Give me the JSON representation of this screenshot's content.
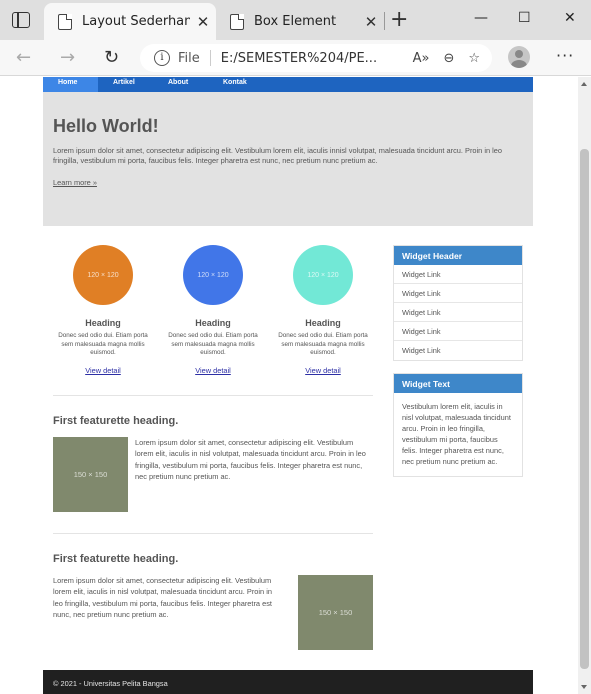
{
  "browser": {
    "tabs": [
      {
        "title": "Layout Sederhana",
        "active": true
      },
      {
        "title": "Box Element",
        "active": false
      }
    ],
    "new_tab_symbol": "+",
    "close_symbol": "✕",
    "window": {
      "minimize": "—",
      "maximize": "☐",
      "close": "✕"
    },
    "address": {
      "protocol": "File",
      "url": "E:/SEMESTER%204/PE..."
    },
    "icons": [
      "tab-actions-icon",
      "back-icon",
      "forward-icon",
      "refresh-icon",
      "info-icon",
      "read-aloud-icon",
      "zoom-icon",
      "favorites-icon",
      "profile-icon",
      "menu-icon"
    ]
  },
  "page": {
    "nav": [
      "Home",
      "Artikel",
      "About",
      "Kontak"
    ],
    "jumbotron": {
      "title": "Hello World!",
      "text": "Lorem ipsum dolor sit amet, consectetur adipiscing elit. Vestibulum lorem elit, iaculis innisl volutpat, malesuada tincidunt arcu. Proin in leo fringilla, vestibulum mi porta, faucibus felis. Integer pharetra est nunc, nec pretium nunc pretium ac.",
      "link": "Learn more »"
    },
    "columns": [
      {
        "img": "120 × 120",
        "heading": "Heading",
        "text": "Donec sed odio dui. Etiam porta sem malesuada magna mollis euismod.",
        "link": "View detail",
        "color": "#e07f25"
      },
      {
        "img": "120 × 120",
        "heading": "Heading",
        "text": "Donec sed odio dui. Etiam porta sem malesuada magna mollis euismod.",
        "link": "View detail",
        "color": "#4176e8"
      },
      {
        "img": "120 × 120",
        "heading": "Heading",
        "text": "Donec sed odio dui. Etiam porta sem malesuada magna mollis euismod.",
        "link": "View detail",
        "color": "#72e8d6"
      }
    ],
    "featurettes": [
      {
        "heading": "First featurette heading.",
        "img": "150 × 150",
        "text": "Lorem ipsum dolor sit amet, consectetur adipiscing elit. Vestibulum lorem elit, iaculis in nisl volutpat, malesuada tincidunt arcu. Proin in leo fringilla, vestibulum mi porta, faucibus felis. Integer pharetra est nunc, nec pretium nunc pretium ac."
      },
      {
        "heading": "First featurette heading.",
        "img": "150 × 150",
        "text": "Lorem ipsum dolor sit amet, consectetur adipiscing elit. Vestibulum lorem elit, iaculis in nisl volutpat, malesuada tincidunt arcu. Proin in leo fringilla, vestibulum mi porta, faucibus felis. Integer pharetra est nunc, nec pretium nunc pretium ac."
      }
    ],
    "widget1": {
      "header": "Widget Header",
      "links": [
        "Widget Link",
        "Widget Link",
        "Widget Link",
        "Widget Link",
        "Widget Link"
      ]
    },
    "widget2": {
      "header": "Widget Text",
      "text": "Vestibulum lorem elit, iaculis in nisl volutpat, malesuada tincidunt arcu. Proin in leo fringilla, vestibulum mi porta, faucibus felis. Integer pharetra est nunc, nec pretium nunc pretium ac."
    },
    "footer": "© 2021 - Universitas Pelita Bangsa"
  },
  "colors": {
    "nav": "#1e64c0",
    "nav_active": "#3d86e6",
    "widget_header": "#3e87c9",
    "footer": "#202020",
    "placeholder": "#80896d"
  }
}
